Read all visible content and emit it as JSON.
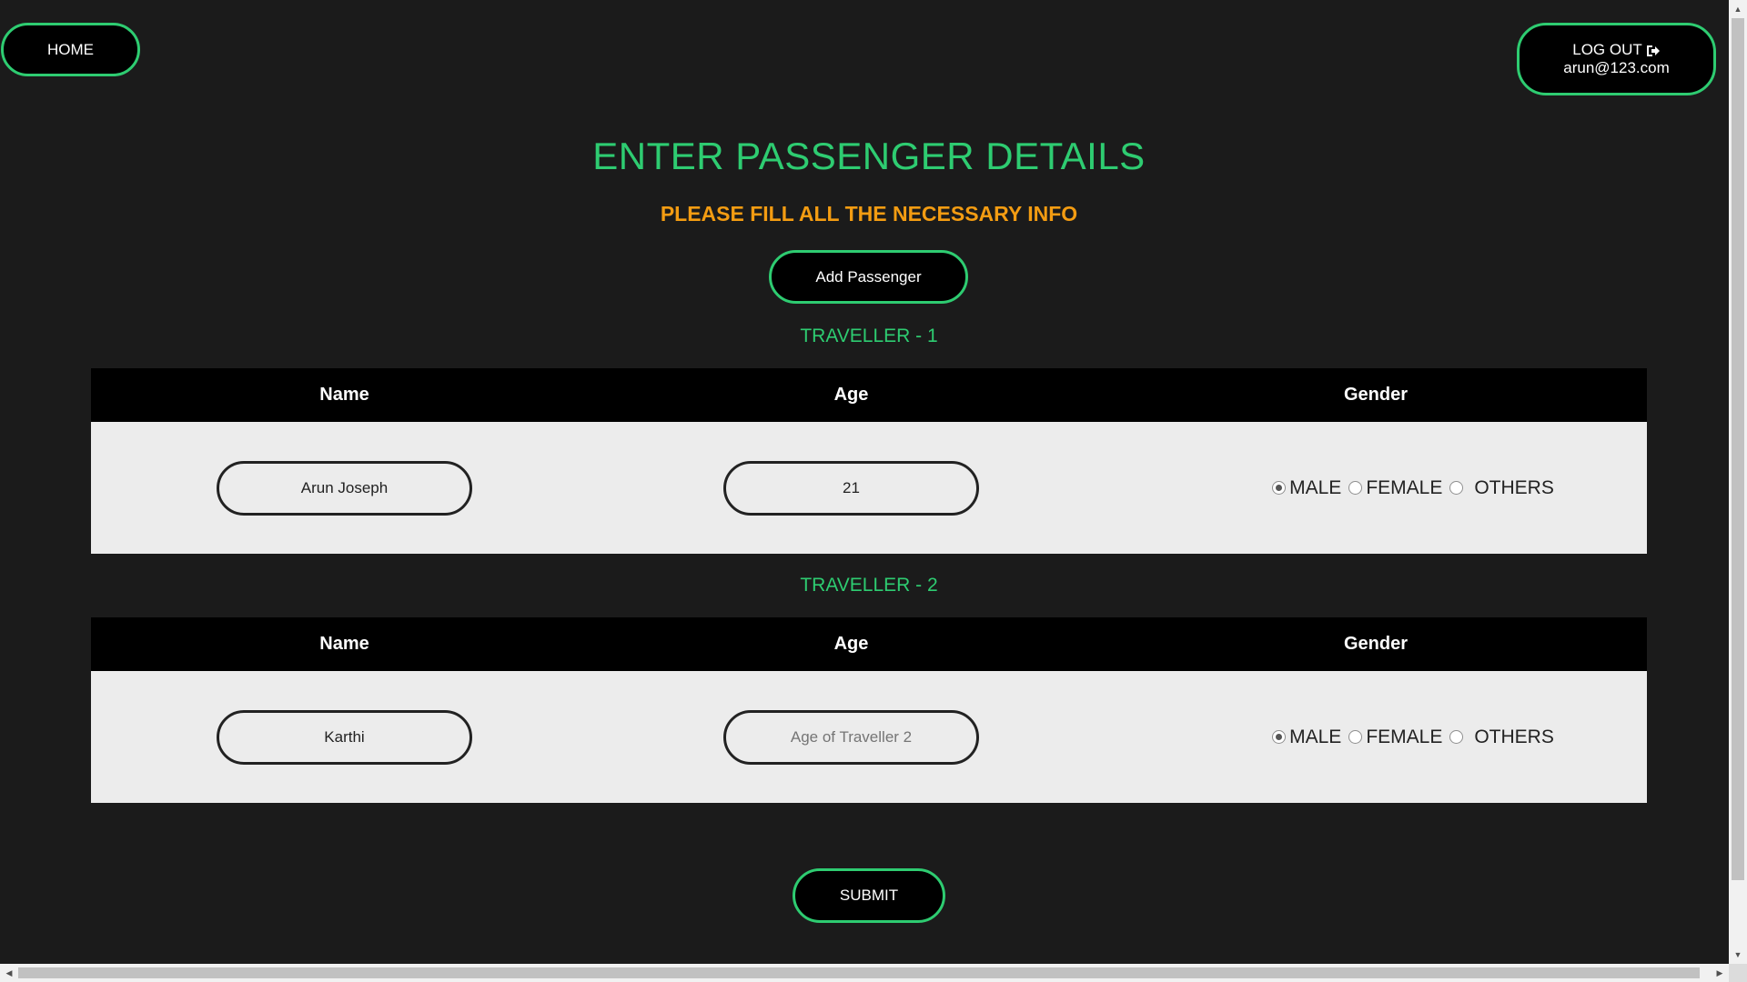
{
  "nav": {
    "home_label": "HOME",
    "logout_label": "LOG OUT",
    "user_email": "arun@123.com"
  },
  "header": {
    "title": "ENTER PASSENGER DETAILS",
    "subtitle": "PLEASE FILL ALL THE NECESSARY INFO"
  },
  "add_passenger_label": "Add Passenger",
  "columns": {
    "name": "Name",
    "age": "Age",
    "gender": "Gender"
  },
  "travellers": [
    {
      "label": "TRAVELLER - 1",
      "name_value": "Arun Joseph",
      "age_value": "21",
      "age_placeholder": "",
      "gender_selected": "MALE"
    },
    {
      "label": "TRAVELLER - 2",
      "name_value": "Karthi",
      "age_value": "",
      "age_placeholder": "Age of Traveller 2",
      "gender_selected": "MALE"
    }
  ],
  "gender_options": [
    "MALE",
    "FEMALE",
    "OTHERS"
  ],
  "submit_label": "SUBMIT",
  "colors": {
    "background": "#1b1b1b",
    "accent_green": "#2ecc71",
    "subtitle_orange": "#f39c12",
    "table_header": "#000000",
    "table_body": "#ececec"
  },
  "icons": {
    "logout": "sign-out-icon"
  }
}
